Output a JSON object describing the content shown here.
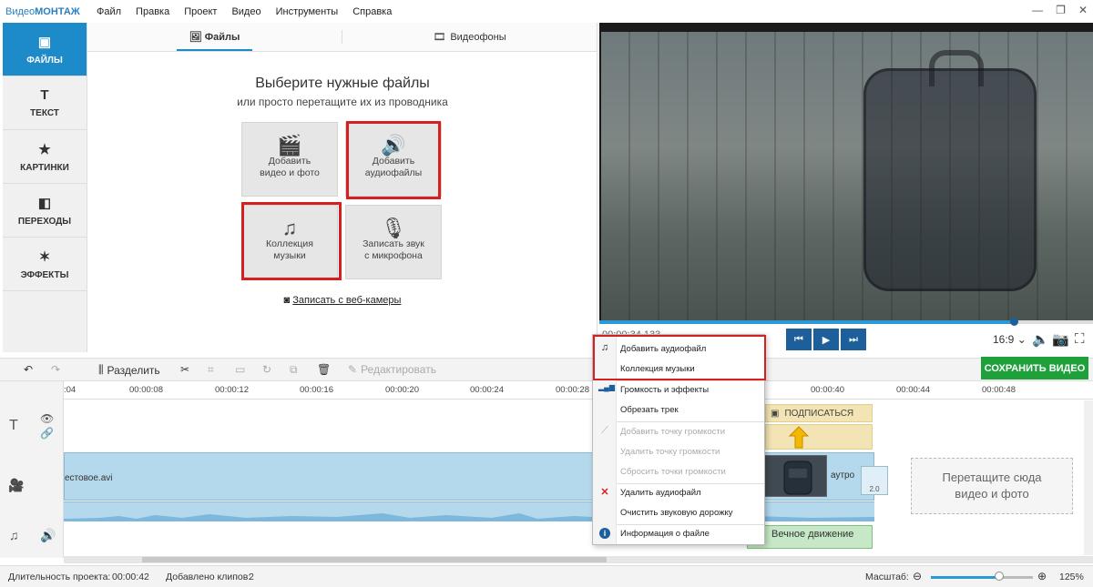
{
  "app": {
    "logo_part1": "Видео",
    "logo_part2": "МОНТАЖ",
    "menu": [
      "Файл",
      "Правка",
      "Проект",
      "Видео",
      "Инструменты",
      "Справка"
    ],
    "window_buttons": {
      "minimize": "—",
      "maximize": "❐",
      "close": "✕"
    }
  },
  "nav": [
    {
      "label": "ФАЙЛЫ",
      "icon": "image-icon",
      "glyph": "▣"
    },
    {
      "label": "ТЕКСТ",
      "icon": "text-icon",
      "glyph": "T"
    },
    {
      "label": "КАРТИНКИ",
      "icon": "star-icon",
      "glyph": "★"
    },
    {
      "label": "ПЕРЕХОДЫ",
      "icon": "transitions-icon",
      "glyph": "◧"
    },
    {
      "label": "ЭФФЕКТЫ",
      "icon": "magic-wand-icon",
      "glyph": "✶"
    }
  ],
  "panel": {
    "tabs": [
      {
        "label": "Файлы",
        "glyph": "🖼"
      },
      {
        "label": "Видеофоны",
        "glyph": "🎞"
      }
    ],
    "title": "Выберите нужные файлы",
    "subtitle": "или просто перетащите их из проводника",
    "tiles": [
      {
        "line1": "Добавить",
        "line2": "видео и фото",
        "glyph": "🎬"
      },
      {
        "line1": "Добавить",
        "line2": "аудиофайлы",
        "glyph": "🔊"
      },
      {
        "line1": "Коллекция",
        "line2": "музыки",
        "glyph": "♫"
      },
      {
        "line1": "Записать звук",
        "line2": "с микрофона",
        "glyph": "🎙"
      }
    ],
    "webcam_label": "Записать с веб-камеры"
  },
  "player": {
    "timecode": "00:00:34.133",
    "progress": 0.84,
    "controls": {
      "prev": "⏮",
      "play": "▶",
      "next": "⏭"
    },
    "aspect_ratio": "16:9 ⌄"
  },
  "toolbar": {
    "undo": "↶",
    "redo": "↷",
    "split_label": "Разделить",
    "edit_label": "Редактировать",
    "save_label": "СОХРАНИТЬ ВИДЕО"
  },
  "timeline": {
    "ticks": [
      ":04",
      "00:00:08",
      "00:00:12",
      "00:00:16",
      "00:00:20",
      "00:00:24",
      "00:00:28",
      "00:00:40",
      "00:00:44",
      "00:00:48"
    ],
    "video_clip_name": "естовое.avi",
    "subscribe_label": "ПОДПИСАТЬСЯ",
    "auto_label": "аутро",
    "transition_label": "2.0",
    "music_clip_name": "Вечное движение",
    "drop_zone": "Перетащите сюда видео и фото"
  },
  "context_menu": {
    "items": [
      {
        "label": "Добавить аудиофайл",
        "enabled": true,
        "glyph": "♫"
      },
      {
        "label": "Коллекция музыки",
        "enabled": true,
        "glyph": ""
      },
      {
        "label": "Громкость и эффекты",
        "enabled": true,
        "glyph": "▂▄▆"
      },
      {
        "label": "Обрезать трек",
        "enabled": true,
        "glyph": ""
      },
      {
        "label": "Добавить точку громкости",
        "enabled": false,
        "glyph": "⟋"
      },
      {
        "label": "Удалить точку громкости",
        "enabled": false,
        "glyph": ""
      },
      {
        "label": "Сбросить точки громкости",
        "enabled": false,
        "glyph": ""
      },
      {
        "label": "Удалить аудиофайл",
        "enabled": true,
        "glyph": "✕"
      },
      {
        "label": "Очистить звуковую дорожку",
        "enabled": true,
        "glyph": ""
      },
      {
        "label": "Информация о файле",
        "enabled": true,
        "glyph": "i"
      }
    ]
  },
  "status": {
    "duration_label": "Длительность проекта:",
    "duration_value": "00:00:42",
    "clips_label": "Добавлено клипов:",
    "clips_value": "2",
    "zoom_label": "Масштаб:",
    "zoom_value": "125%",
    "zoom_level": 0.67
  },
  "colors": {
    "accent": "#1d8ac9",
    "save": "#1ea03a",
    "highlight": "#d62020"
  }
}
